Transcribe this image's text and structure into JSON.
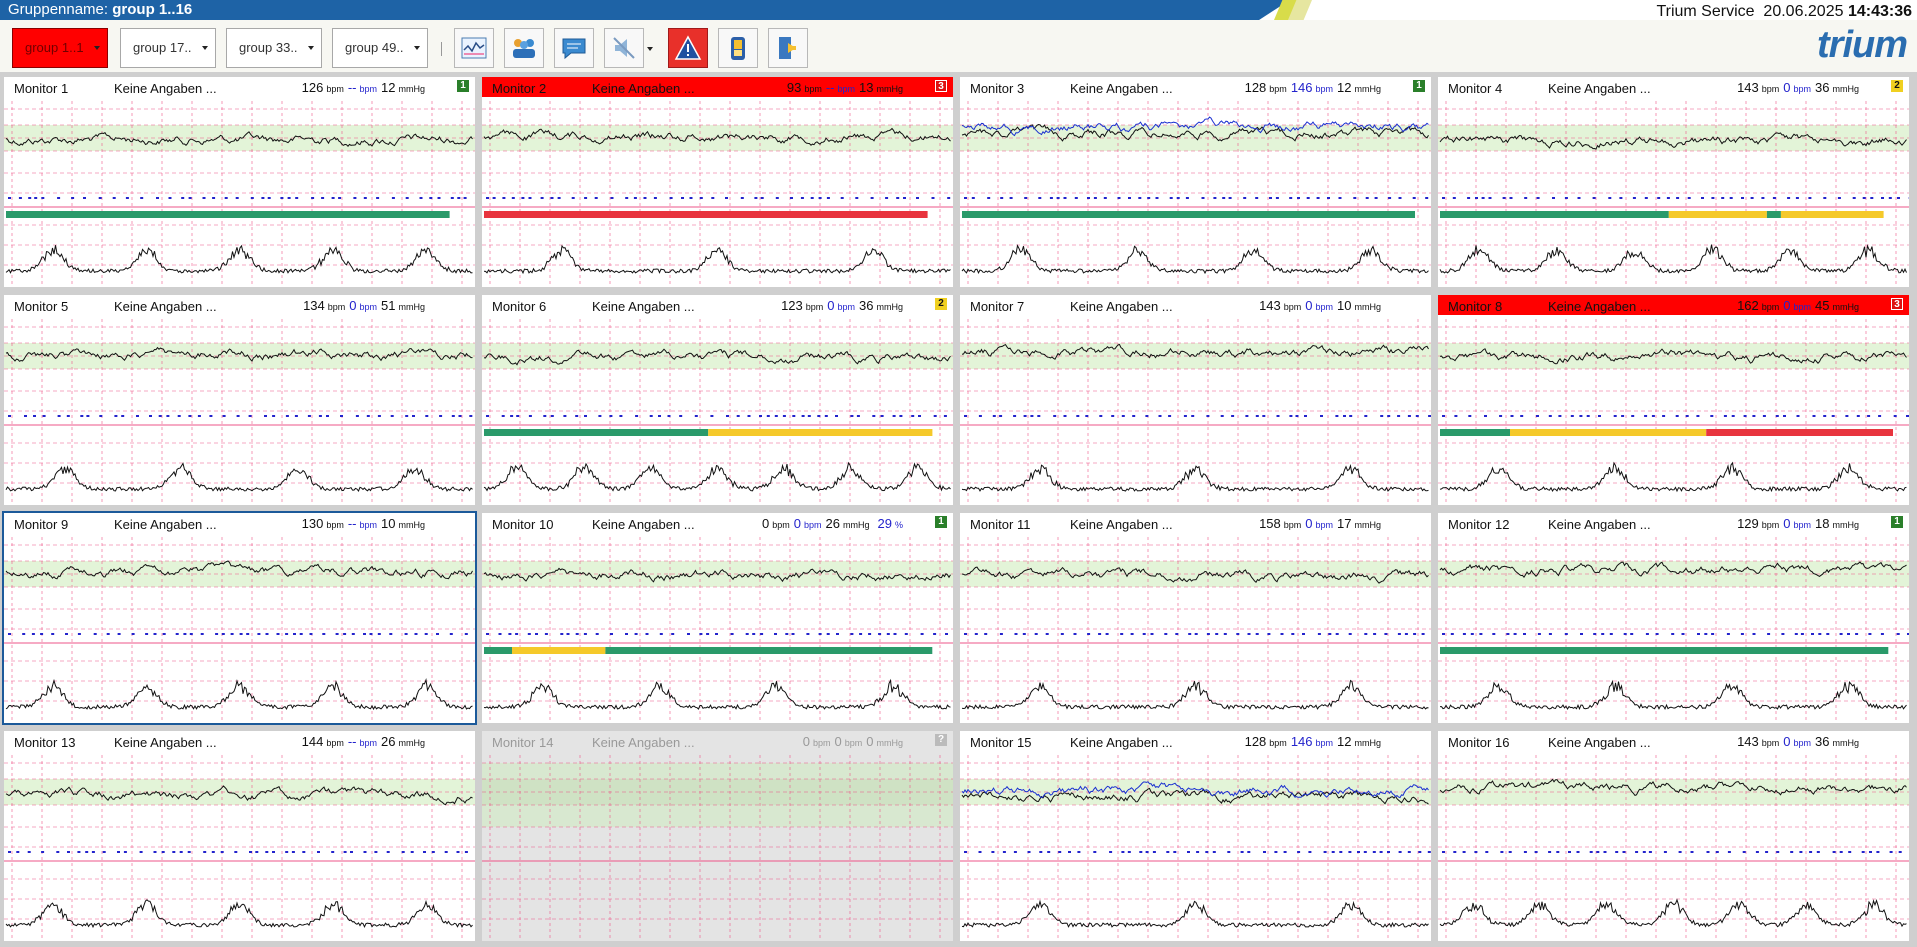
{
  "header": {
    "group_label": "Gruppenname:",
    "group_value": "group 1..16",
    "service": "Trium Service",
    "date": "20.06.2025",
    "time": "14:43:36",
    "bar_color": "#1e63a6"
  },
  "toolbar": {
    "groups": [
      {
        "label": "group 1..1",
        "active": true
      },
      {
        "label": "group 17..",
        "active": false
      },
      {
        "label": "group 33..",
        "active": false
      },
      {
        "label": "group 49..",
        "active": false
      }
    ],
    "icons": [
      "ctg-overview-icon",
      "patients-icon",
      "chat-icon",
      "mute-icon",
      "alarm-warning-icon",
      "battery-icon",
      "logout-icon"
    ],
    "logo": "trium"
  },
  "monitors": [
    {
      "name": "Monitor 1",
      "status": "Keine Angaben ...",
      "hr": "126",
      "hr2": "--",
      "toco": "12",
      "badge": "1",
      "state": "normal",
      "bar": [
        [
          "g",
          95
        ]
      ]
    },
    {
      "name": "Monitor 2",
      "status": "Keine Angaben ...",
      "hr": "93",
      "hr2": "--",
      "toco": "13",
      "badge": "3",
      "state": "alarm",
      "bar": [
        [
          "r",
          95
        ]
      ]
    },
    {
      "name": "Monitor 3",
      "status": "Keine Angaben ...",
      "hr": "128",
      "hr2": "146",
      "toco": "12",
      "badge": "1",
      "state": "normal",
      "bar": [
        [
          "g",
          97
        ]
      ]
    },
    {
      "name": "Monitor 4",
      "status": "Keine Angaben ...",
      "hr": "143",
      "hr2": "0",
      "toco": "36",
      "badge": "2",
      "state": "normal",
      "bar": [
        [
          "g",
          49
        ],
        [
          "y",
          21
        ],
        [
          "g",
          3
        ],
        [
          "y",
          22
        ]
      ]
    },
    {
      "name": "Monitor 5",
      "status": "Keine Angaben ...",
      "hr": "134",
      "hr2": "0",
      "toco": "51",
      "badge": "",
      "state": "normal",
      "bar": []
    },
    {
      "name": "Monitor 6",
      "status": "Keine Angaben ...",
      "hr": "123",
      "hr2": "0",
      "toco": "36",
      "badge": "2",
      "state": "normal",
      "bar": [
        [
          "g",
          48
        ],
        [
          "y",
          48
        ]
      ]
    },
    {
      "name": "Monitor 7",
      "status": "Keine Angaben ...",
      "hr": "143",
      "hr2": "0",
      "toco": "10",
      "badge": "",
      "state": "normal",
      "bar": []
    },
    {
      "name": "Monitor 8",
      "status": "Keine Angaben ...",
      "hr": "162",
      "hr2": "0",
      "toco": "45",
      "badge": "3",
      "state": "alarm",
      "bar": [
        [
          "g",
          15
        ],
        [
          "y",
          42
        ],
        [
          "r",
          40
        ]
      ]
    },
    {
      "name": "Monitor 9",
      "status": "Keine Angaben ...",
      "hr": "130",
      "hr2": "--",
      "toco": "10",
      "badge": "",
      "state": "selected",
      "bar": []
    },
    {
      "name": "Monitor 10",
      "status": "Keine Angaben ...",
      "hr": "0",
      "hr2": "0",
      "toco": "26",
      "spo2": "29",
      "badge": "1",
      "state": "normal",
      "bar": [
        [
          "g",
          6
        ],
        [
          "y",
          20
        ],
        [
          "g",
          70
        ]
      ]
    },
    {
      "name": "Monitor 11",
      "status": "Keine Angaben ...",
      "hr": "158",
      "hr2": "0",
      "toco": "17",
      "badge": "",
      "state": "normal",
      "bar": []
    },
    {
      "name": "Monitor 12",
      "status": "Keine Angaben ...",
      "hr": "129",
      "hr2": "0",
      "toco": "18",
      "badge": "1",
      "state": "normal",
      "bar": [
        [
          "g",
          96
        ]
      ]
    },
    {
      "name": "Monitor 13",
      "status": "Keine Angaben ...",
      "hr": "144",
      "hr2": "--",
      "toco": "26",
      "badge": "",
      "state": "normal",
      "bar": []
    },
    {
      "name": "Monitor 14",
      "status": "Keine Angaben ...",
      "hr": "0",
      "hr2": "0",
      "toco": "0",
      "badge": "?",
      "state": "offline",
      "bar": []
    },
    {
      "name": "Monitor 15",
      "status": "Keine Angaben ...",
      "hr": "128",
      "hr2": "146",
      "toco": "12",
      "badge": "",
      "state": "normal",
      "bar": []
    },
    {
      "name": "Monitor 16",
      "status": "Keine Angaben ...",
      "hr": "143",
      "hr2": "0",
      "toco": "36",
      "badge": "",
      "state": "normal",
      "bar": []
    }
  ],
  "units": {
    "bpm": "bpm",
    "mmhg": "mmHg",
    "pct": "%"
  },
  "colors": {
    "green": "#2a9a6a",
    "yellow": "#f5c92a",
    "red": "#e8343e",
    "grid": "#ee5588",
    "band": "#e3f4d8",
    "blue_trace": "#1a2fd0"
  }
}
